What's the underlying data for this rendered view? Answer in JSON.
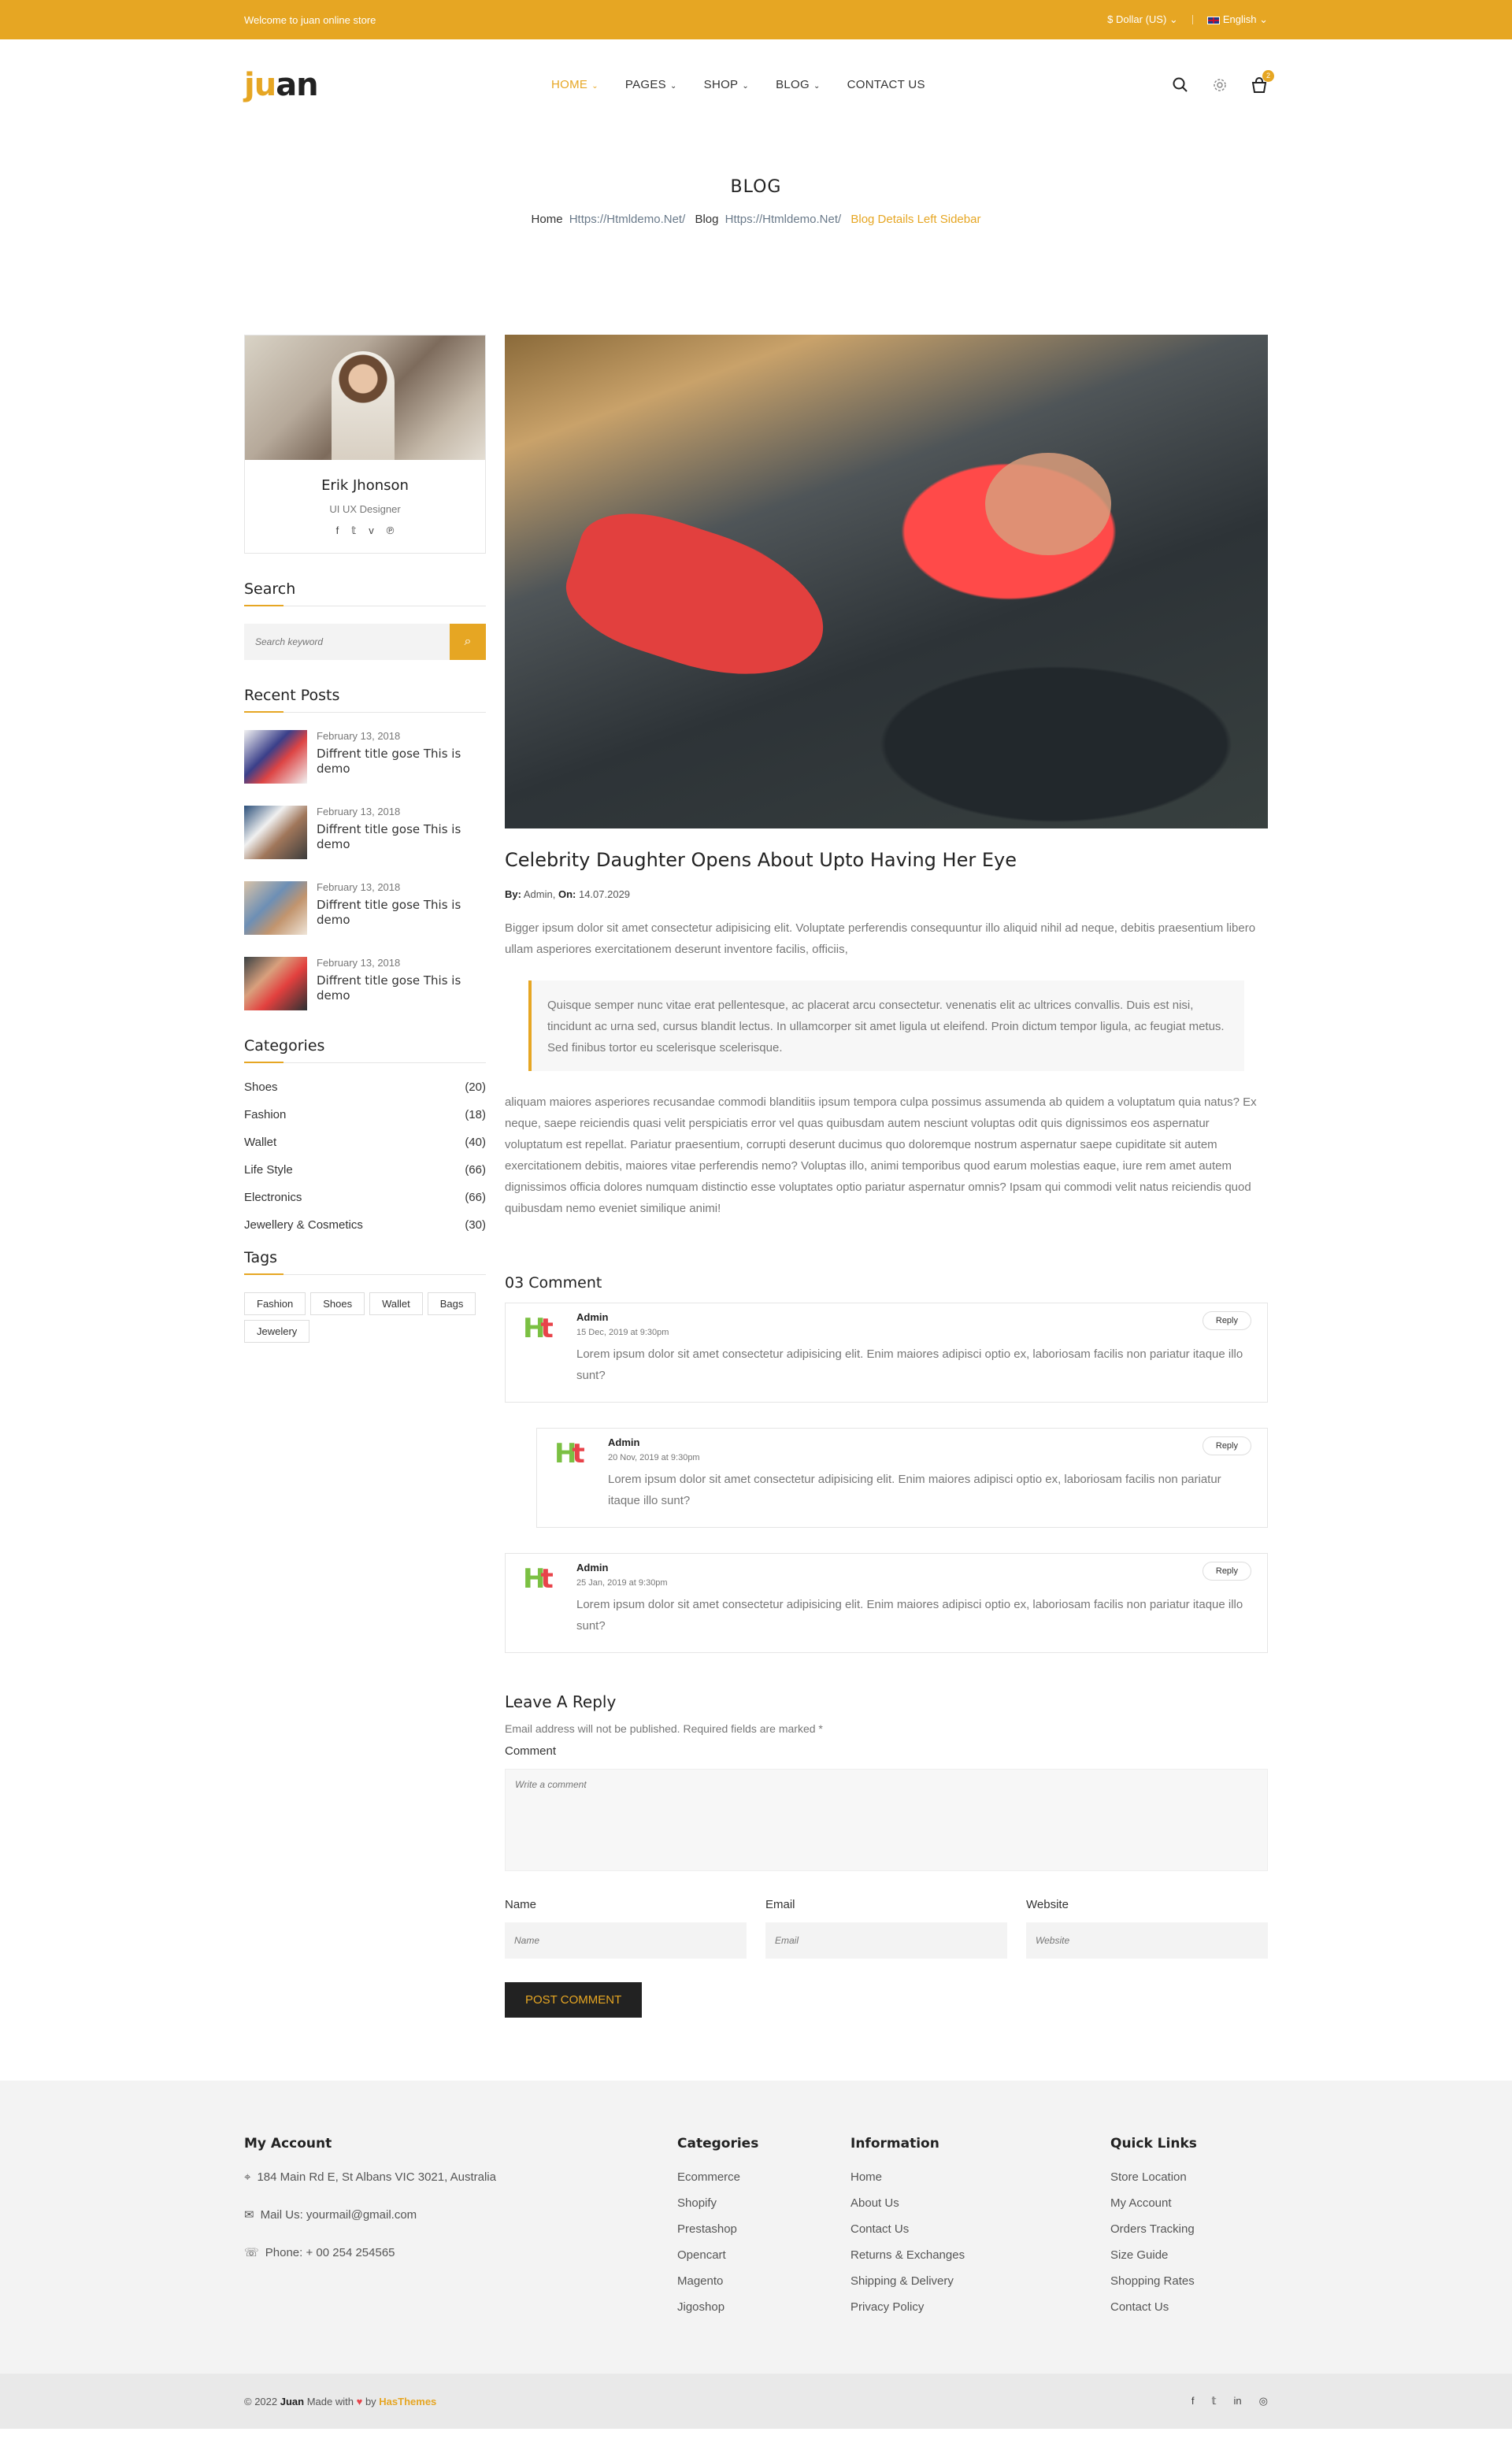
{
  "topbar": {
    "welcome": "Welcome to juan online store",
    "currency": "$ Dollar (US)",
    "language": "English"
  },
  "header": {
    "logo_ju": "ju",
    "logo_an": "an",
    "nav": [
      {
        "label": "HOME",
        "has_menu": true
      },
      {
        "label": "PAGES",
        "has_menu": true
      },
      {
        "label": "SHOP",
        "has_menu": true
      },
      {
        "label": "BLOG",
        "has_menu": true
      },
      {
        "label": "CONTACT US",
        "has_menu": false
      }
    ],
    "cart_count": "2"
  },
  "breadcrumb": {
    "title": "BLOG",
    "items": [
      "Home",
      "Https://Htmldemo.Net/",
      "Blog",
      "Https://Htmldemo.Net/",
      "Blog Details Left Sidebar"
    ]
  },
  "author": {
    "name": "Erik Jhonson",
    "role": "UI UX Designer"
  },
  "sidebar": {
    "search_title": "Search",
    "search_placeholder": "Search keyword",
    "recent_title": "Recent Posts",
    "recent_posts": [
      {
        "date": "February 13, 2018",
        "title": "Diffrent title gose This is demo"
      },
      {
        "date": "February 13, 2018",
        "title": "Diffrent title gose This is demo"
      },
      {
        "date": "February 13, 2018",
        "title": "Diffrent title gose This is demo"
      },
      {
        "date": "February 13, 2018",
        "title": "Diffrent title gose This is demo"
      }
    ],
    "categories_title": "Categories",
    "categories": [
      {
        "name": "Shoes",
        "count": "(20)"
      },
      {
        "name": "Fashion",
        "count": "(18)"
      },
      {
        "name": "Wallet",
        "count": "(40)"
      },
      {
        "name": "Life Style",
        "count": "(66)"
      },
      {
        "name": "Electronics",
        "count": "(66)"
      },
      {
        "name": "Jewellery & Cosmetics",
        "count": "(30)"
      }
    ],
    "tags_title": "Tags",
    "tags": [
      "Fashion",
      "Shoes",
      "Wallet",
      "Bags",
      "Jewelery"
    ]
  },
  "post": {
    "title": "Celebrity Daughter Opens About Upto Having Her Eye",
    "by_label": "By:",
    "author": "Admin,",
    "on_label": "On:",
    "date": "14.07.2029",
    "intro": "Bigger ipsum dolor sit amet consectetur adipisicing elit. Voluptate perferendis consequuntur illo aliquid nihil ad neque, debitis praesentium libero ullam asperiores exercitationem deserunt inventore facilis, officiis,",
    "quote": "Quisque semper nunc vitae erat pellentesque, ac placerat arcu consectetur. venenatis elit ac ultrices convallis. Duis est nisi, tincidunt ac urna sed, cursus blandit lectus. In ullamcorper sit amet ligula ut eleifend. Proin dictum tempor ligula, ac feugiat metus. Sed finibus tortor eu scelerisque scelerisque.",
    "body": "aliquam maiores asperiores recusandae commodi blanditiis ipsum tempora culpa possimus assumenda ab quidem a voluptatum quia natus? Ex neque, saepe reiciendis quasi velit perspiciatis error vel quas quibusdam autem nesciunt voluptas odit quis dignissimos eos aspernatur voluptatum est repellat. Pariatur praesentium, corrupti deserunt ducimus quo doloremque nostrum aspernatur saepe cupiditate sit autem exercitationem debitis, maiores vitae perferendis nemo? Voluptas illo, animi temporibus quod earum molestias eaque, iure rem amet autem dignissimos officia dolores numquam distinctio esse voluptates optio pariatur aspernatur omnis? Ipsam qui commodi velit natus reiciendis quod quibusdam nemo eveniet similique animi!"
  },
  "comments": {
    "title": "03 Comment",
    "reply_label": "Reply",
    "items": [
      {
        "name": "Admin",
        "date": "15 Dec, 2019 at 9:30pm",
        "text": "Lorem ipsum dolor sit amet consectetur adipisicing elit. Enim maiores adipisci optio ex, laboriosam facilis non pariatur itaque illo sunt?"
      },
      {
        "name": "Admin",
        "date": "20 Nov, 2019 at 9:30pm",
        "text": "Lorem ipsum dolor sit amet consectetur adipisicing elit. Enim maiores adipisci optio ex, laboriosam facilis non pariatur itaque illo sunt?"
      },
      {
        "name": "Admin",
        "date": "25 Jan, 2019 at 9:30pm",
        "text": "Lorem ipsum dolor sit amet consectetur adipisicing elit. Enim maiores adipisci optio ex, laboriosam facilis non pariatur itaque illo sunt?"
      }
    ]
  },
  "reply_form": {
    "title": "Leave A Reply",
    "note": "Email address will not be published. Required fields are marked *",
    "comment_label": "Comment",
    "comment_placeholder": "Write a comment",
    "name_label": "Name",
    "name_placeholder": "Name",
    "email_label": "Email",
    "email_placeholder": "Email",
    "website_label": "Website",
    "website_placeholder": "Website",
    "submit": "POST COMMENT"
  },
  "footer": {
    "account_title": "My Account",
    "address": "184 Main Rd E, St Albans VIC 3021, Australia",
    "mail": "Mail Us: yourmail@gmail.com",
    "phone": "Phone: + 00 254 254565",
    "categories_title": "Categories",
    "categories": [
      "Ecommerce",
      "Shopify",
      "Prestashop",
      "Opencart",
      "Magento",
      "Jigoshop"
    ],
    "information_title": "Information",
    "information": [
      "Home",
      "About Us",
      "Contact Us",
      "Returns & Exchanges",
      "Shipping & Delivery",
      "Privacy Policy"
    ],
    "quick_title": "Quick Links",
    "quick": [
      "Store Location",
      "My Account",
      "Orders Tracking",
      "Size Guide",
      "Shopping Rates",
      "Contact Us"
    ]
  },
  "copyright": {
    "prefix": "© 2022",
    "brand_name": "Juan",
    "made_with": "Made with",
    "by": "by",
    "company": "HasThemes"
  },
  "colors": {
    "accent": "#e6a623",
    "dark": "#222222"
  }
}
